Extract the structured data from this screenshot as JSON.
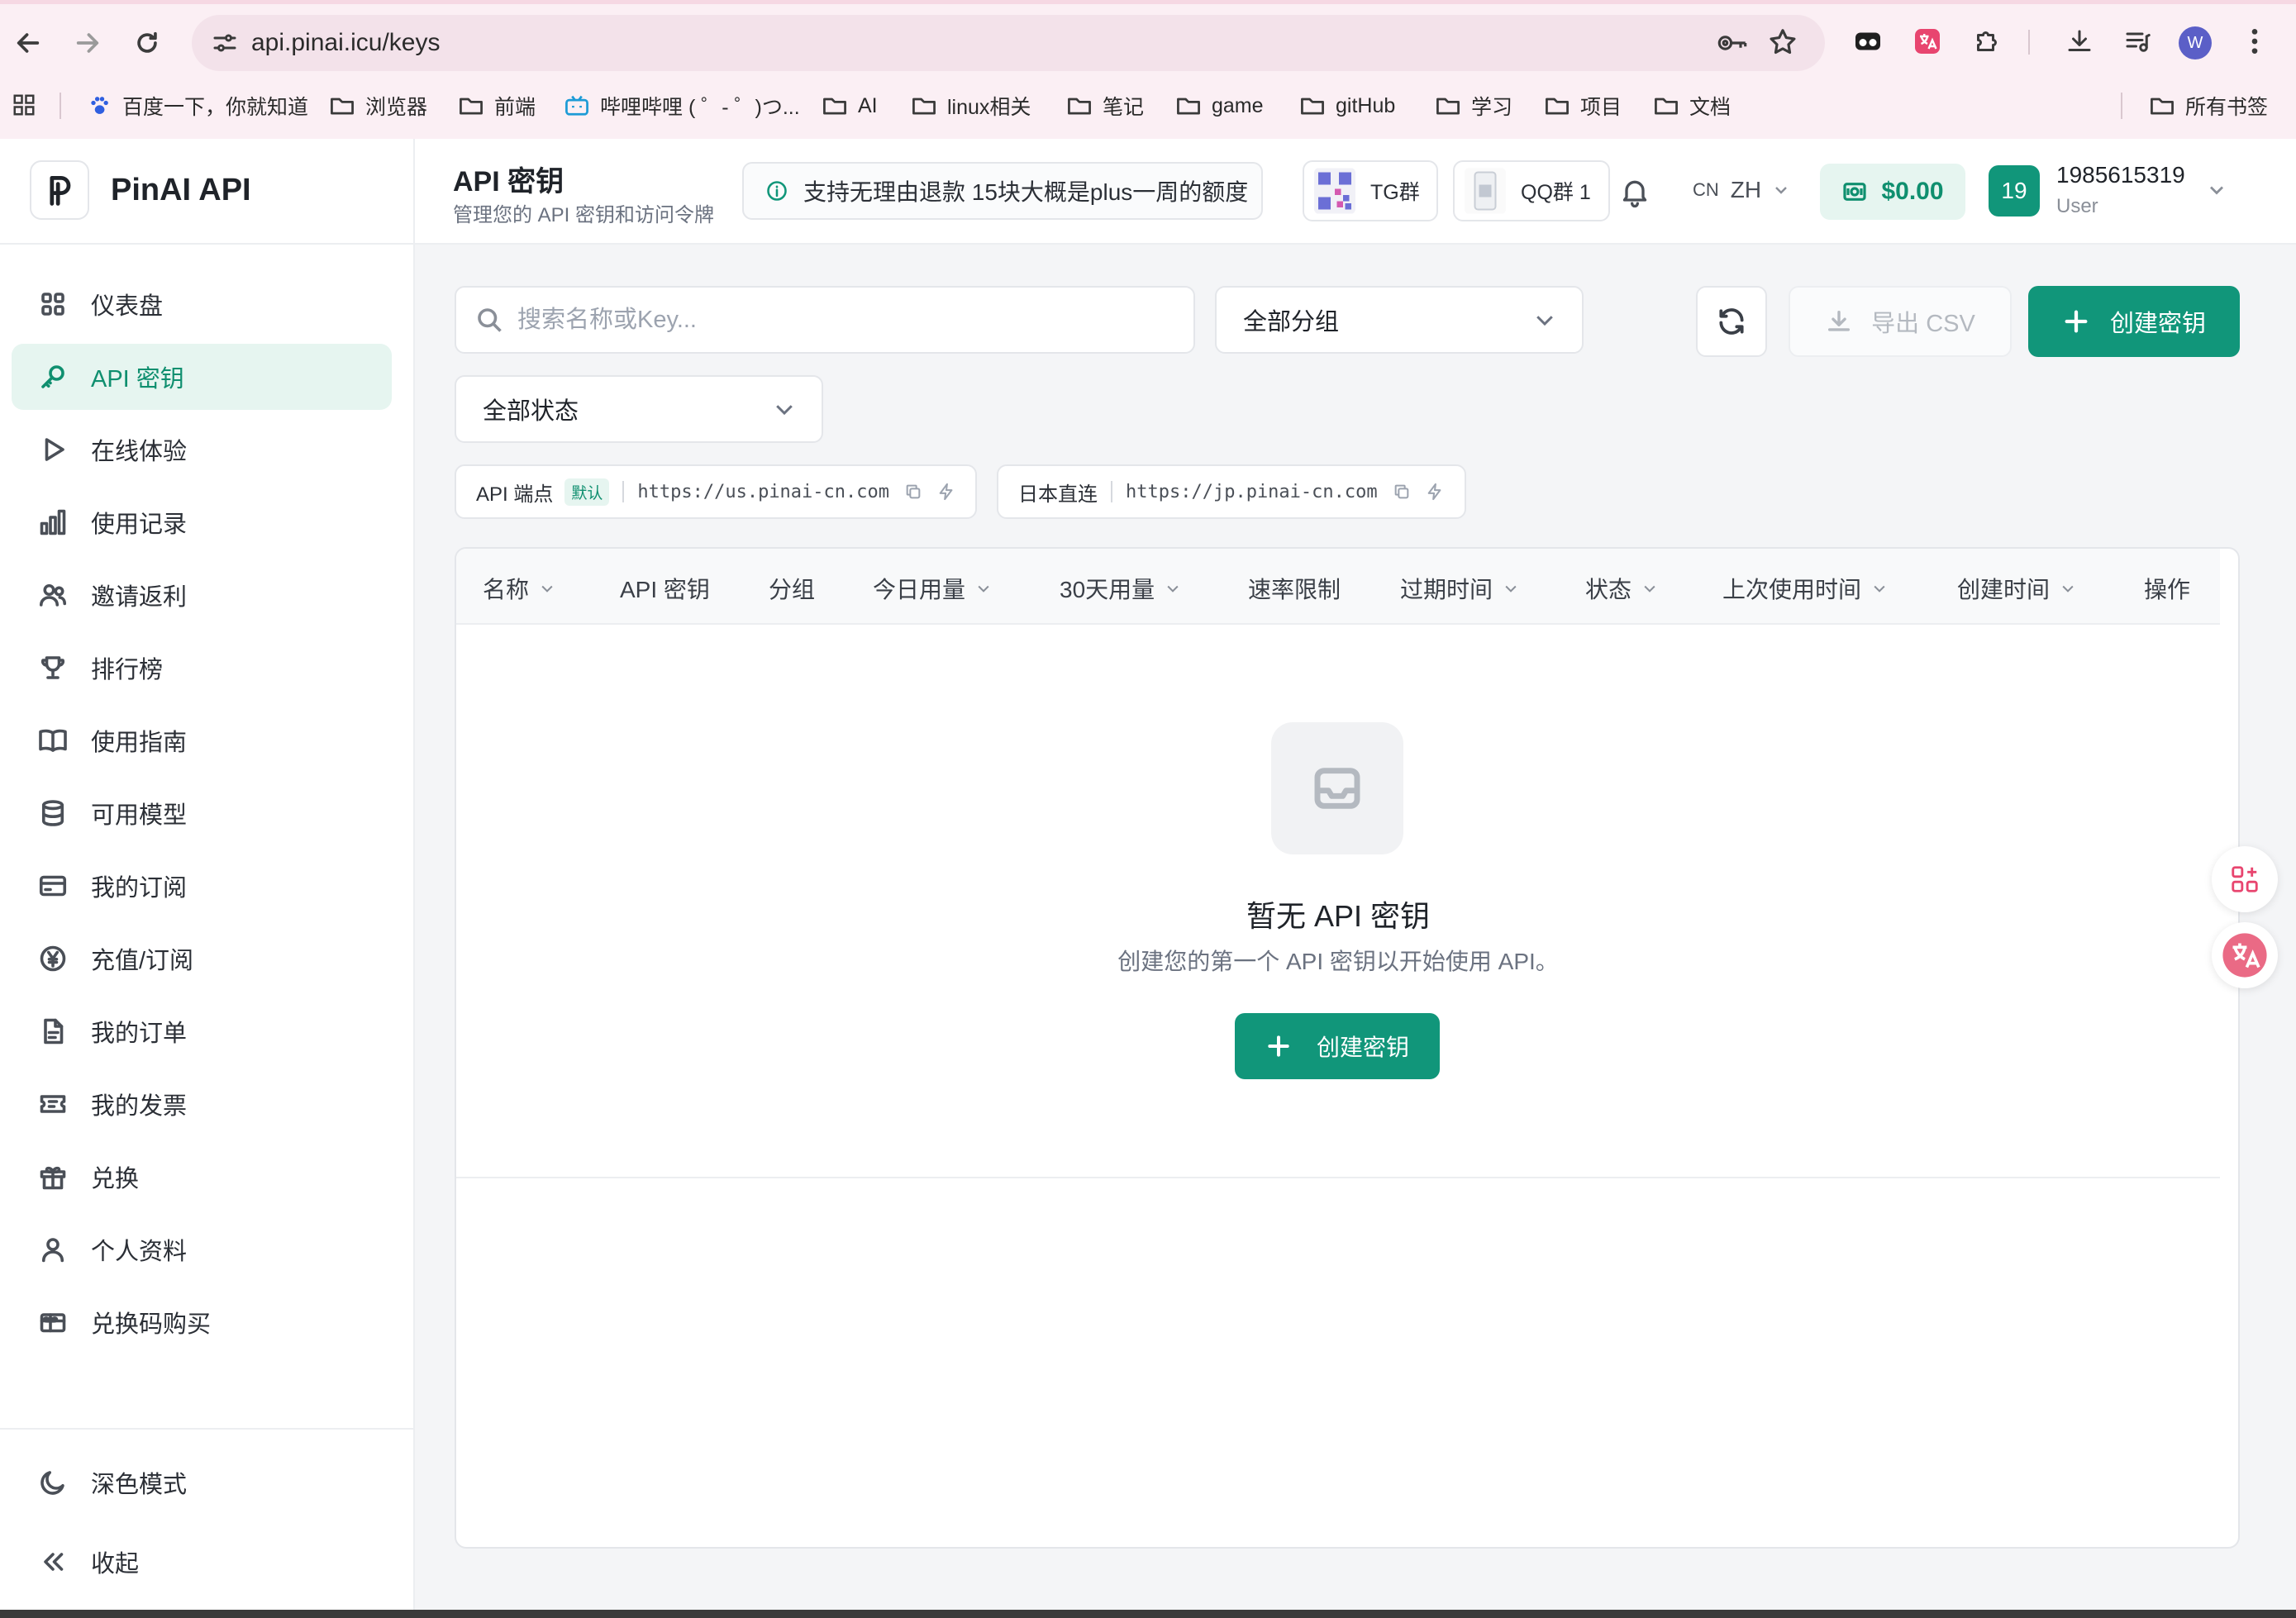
{
  "browser": {
    "url": "api.pinai.icu/keys",
    "profile_initial": "W",
    "bookmarks": [
      {
        "label": "百度一下，你就知道",
        "icon": "paw-icon"
      },
      {
        "label": "浏览器",
        "icon": "folder-icon"
      },
      {
        "label": "前端",
        "icon": "folder-icon"
      },
      {
        "label": "哔哩哔哩 ( ゜- ゜)つ...",
        "icon": "bilibili-icon"
      },
      {
        "label": "AI",
        "icon": "folder-icon"
      },
      {
        "label": "linux相关",
        "icon": "folder-icon"
      },
      {
        "label": "笔记",
        "icon": "folder-icon"
      },
      {
        "label": "game",
        "icon": "folder-icon"
      },
      {
        "label": "gitHub",
        "icon": "folder-icon"
      },
      {
        "label": "学习",
        "icon": "folder-icon"
      },
      {
        "label": "项目",
        "icon": "folder-icon"
      },
      {
        "label": "文档",
        "icon": "folder-icon"
      }
    ],
    "all_bookmarks": "所有书签"
  },
  "app": {
    "name": "PinAI API",
    "accent": "#11967a"
  },
  "sidebar": {
    "items": [
      {
        "label": "仪表盘",
        "icon": "grid-icon"
      },
      {
        "label": "API 密钥",
        "icon": "key-icon",
        "active": true
      },
      {
        "label": "在线体验",
        "icon": "play-icon"
      },
      {
        "label": "使用记录",
        "icon": "bar-chart-icon"
      },
      {
        "label": "邀请返利",
        "icon": "users-icon"
      },
      {
        "label": "排行榜",
        "icon": "trophy-icon"
      },
      {
        "label": "使用指南",
        "icon": "book-icon"
      },
      {
        "label": "可用模型",
        "icon": "database-icon"
      },
      {
        "label": "我的订阅",
        "icon": "card-icon"
      },
      {
        "label": "充值/订阅",
        "icon": "yen-icon"
      },
      {
        "label": "我的订单",
        "icon": "document-icon"
      },
      {
        "label": "我的发票",
        "icon": "ticket-icon"
      },
      {
        "label": "兑换",
        "icon": "gift-icon"
      },
      {
        "label": "个人资料",
        "icon": "user-icon"
      },
      {
        "label": "兑换码购买",
        "icon": "giftcard-icon"
      }
    ],
    "dark_mode": "深色模式",
    "collapse": "收起"
  },
  "header": {
    "title": "API 密钥",
    "subtitle": "管理您的 API 密钥和访问令牌",
    "notice": "支持无理由退款 15块大概是plus一周的额度",
    "tg_label": "TG群",
    "qq_label": "QQ群 1",
    "lang_region": "CN",
    "lang": "ZH",
    "balance": "$0.00",
    "user_avatar": "19",
    "user_name": "1985615319",
    "user_role": "User"
  },
  "toolbar": {
    "search_placeholder": "搜索名称或Key...",
    "group_select": "全部分组",
    "status_select": "全部状态",
    "export_label": "导出 CSV",
    "create_label": "创建密钥"
  },
  "endpoints": [
    {
      "label": "API 端点",
      "badge": "默认",
      "url": "https://us.pinai-cn.com"
    },
    {
      "label": "日本直连",
      "badge": "",
      "url": "https://jp.pinai-cn.com"
    }
  ],
  "table": {
    "columns": [
      {
        "label": "名称",
        "sortable": true
      },
      {
        "label": "API 密钥",
        "sortable": false
      },
      {
        "label": "分组",
        "sortable": false
      },
      {
        "label": "今日用量",
        "sortable": true
      },
      {
        "label": "30天用量",
        "sortable": true
      },
      {
        "label": "速率限制",
        "sortable": false
      },
      {
        "label": "过期时间",
        "sortable": true
      },
      {
        "label": "状态",
        "sortable": true
      },
      {
        "label": "上次使用时间",
        "sortable": true
      },
      {
        "label": "创建时间",
        "sortable": true
      },
      {
        "label": "操作",
        "sortable": false
      }
    ],
    "empty_title": "暂无 API 密钥",
    "empty_desc": "创建您的第一个 API 密钥以开始使用 API。",
    "empty_create": "创建密钥"
  }
}
